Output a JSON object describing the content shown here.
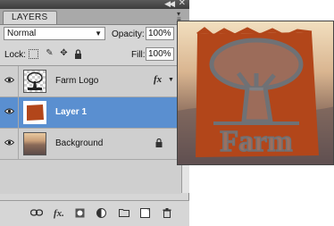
{
  "panel": {
    "tab_label": "LAYERS",
    "blend_mode": "Normal",
    "opacity_label": "Opacity:",
    "opacity_value": "100%",
    "lock_label": "Lock:",
    "fill_label": "Fill:",
    "fill_value": "100%"
  },
  "layers": [
    {
      "name": "Farm Logo",
      "has_fx": true,
      "fx_label": "fx",
      "selected": false,
      "locked": false
    },
    {
      "name": "Layer 1",
      "has_fx": false,
      "selected": true,
      "locked": false
    },
    {
      "name": "Background",
      "has_fx": false,
      "selected": false,
      "locked": true
    }
  ],
  "bottom_toolbar": {
    "link_icon": "link-icon",
    "fx_label": "fx.",
    "icons": [
      "link-icon",
      "fx-icon",
      "mask-icon",
      "adjustment-icon",
      "group-folder-icon",
      "new-layer-icon",
      "trash-icon"
    ]
  },
  "canvas": {
    "logo_text": "Farm",
    "logo_color": "#b2461a"
  },
  "colors": {
    "selected_row": "#5a8fd0",
    "panel_bg": "#d6d6d6"
  }
}
